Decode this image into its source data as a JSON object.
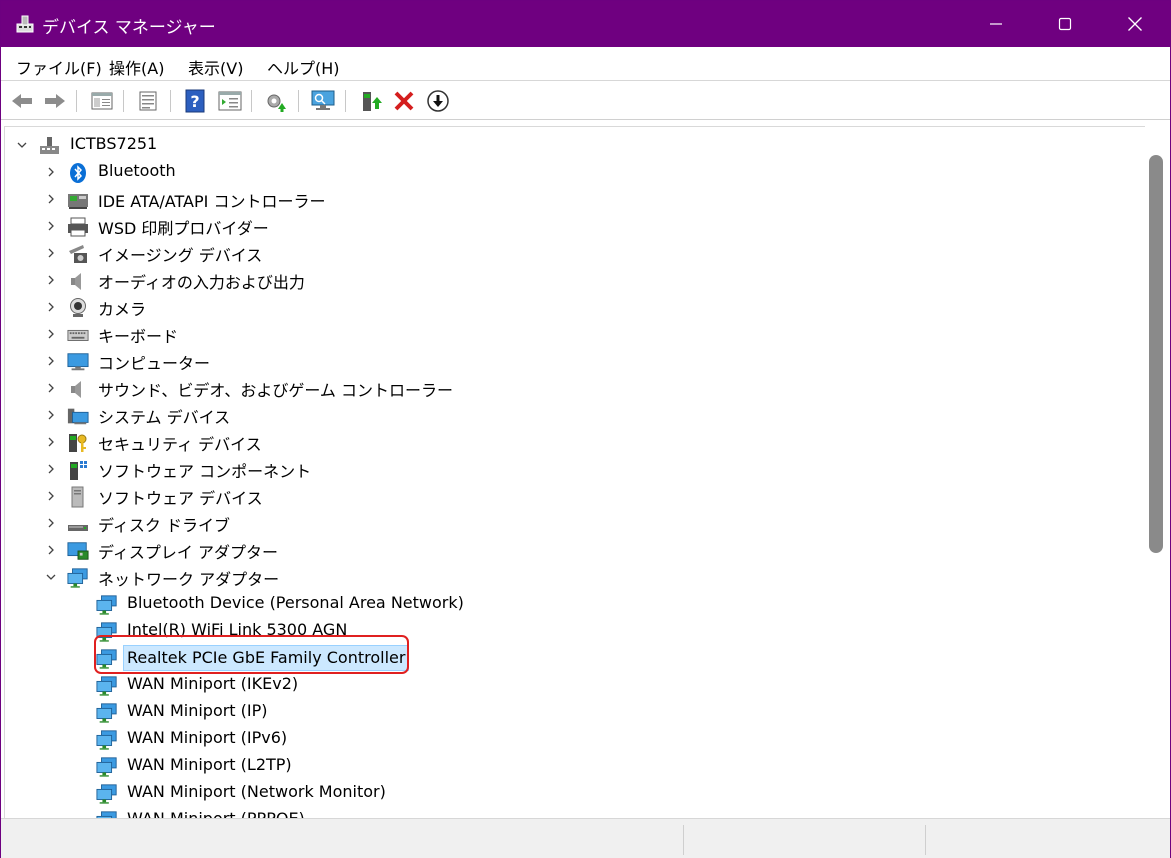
{
  "window": {
    "title": "デバイス マネージャー",
    "titlebar_color": "#6f0080"
  },
  "menu": [
    "ファイル(F)",
    "操作(A)",
    "表示(V)",
    "ヘルプ(H)"
  ],
  "toolbar": {
    "buttons": [
      "back-arrow-icon",
      "forward-arrow-icon",
      "show-hide-console-tree-icon",
      "properties-icon",
      "help-icon",
      "view-icon",
      "update-driver-icon",
      "scan-hardware-icon",
      "enable-device-icon",
      "uninstall-device-icon",
      "disable-device-icon"
    ]
  },
  "tree": {
    "root": "ICTBS7251",
    "categories": [
      {
        "label": "Bluetooth",
        "icon": "bluetooth-icon",
        "expanded": false
      },
      {
        "label": "IDE ATA/ATAPI コントローラー",
        "icon": "ide-controller-icon",
        "expanded": false
      },
      {
        "label": "WSD 印刷プロバイダー",
        "icon": "printer-icon",
        "expanded": false
      },
      {
        "label": "イメージング デバイス",
        "icon": "imaging-device-icon",
        "expanded": false
      },
      {
        "label": "オーディオの入力および出力",
        "icon": "speaker-icon",
        "expanded": false
      },
      {
        "label": "カメラ",
        "icon": "camera-icon",
        "expanded": false
      },
      {
        "label": "キーボード",
        "icon": "keyboard-icon",
        "expanded": false
      },
      {
        "label": "コンピューター",
        "icon": "computer-icon",
        "expanded": false
      },
      {
        "label": "サウンド、ビデオ、およびゲーム コントローラー",
        "icon": "speaker-icon",
        "expanded": false
      },
      {
        "label": "システム デバイス",
        "icon": "system-device-icon",
        "expanded": false
      },
      {
        "label": "セキュリティ デバイス",
        "icon": "security-device-icon",
        "expanded": false
      },
      {
        "label": "ソフトウェア コンポーネント",
        "icon": "software-component-icon",
        "expanded": false
      },
      {
        "label": "ソフトウェア デバイス",
        "icon": "software-device-icon",
        "expanded": false
      },
      {
        "label": "ディスク ドライブ",
        "icon": "disk-drive-icon",
        "expanded": false
      },
      {
        "label": "ディスプレイ アダプター",
        "icon": "display-adapter-icon",
        "expanded": false
      },
      {
        "label": "ネットワーク アダプター",
        "icon": "network-adapter-icon",
        "expanded": true
      }
    ],
    "network_adapters": [
      "Bluetooth Device (Personal Area Network)",
      "Intel(R) WiFi Link 5300 AGN",
      "Realtek PCIe GbE Family Controller",
      "WAN Miniport (IKEv2)",
      "WAN Miniport (IP)",
      "WAN Miniport (IPv6)",
      "WAN Miniport (L2TP)",
      "WAN Miniport (Network Monitor)",
      "WAN Miniport (PPPOE)"
    ],
    "selected": "Realtek PCIe GbE Family Controller",
    "highlight_color": "#e02020"
  }
}
